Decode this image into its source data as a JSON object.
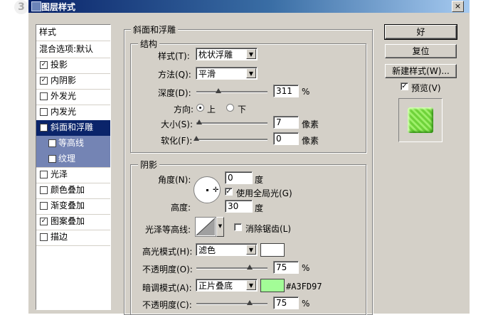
{
  "step": "3",
  "window": {
    "title": "图层样式",
    "close": "×"
  },
  "sidebar": {
    "header": "样式",
    "blend_options": "混合选项:默认",
    "items": [
      {
        "label": "投影",
        "checked": true
      },
      {
        "label": "内阴影",
        "checked": true
      },
      {
        "label": "外发光",
        "checked": false
      },
      {
        "label": "内发光",
        "checked": false
      },
      {
        "label": "斜面和浮雕",
        "checked": true
      },
      {
        "label": "等高线",
        "checked": true
      },
      {
        "label": "纹理",
        "checked": false
      },
      {
        "label": "光泽",
        "checked": false
      },
      {
        "label": "颜色叠加",
        "checked": false
      },
      {
        "label": "渐变叠加",
        "checked": false
      },
      {
        "label": "图案叠加",
        "checked": true
      },
      {
        "label": "描边",
        "checked": false
      }
    ]
  },
  "panel": {
    "title": "斜面和浮雕",
    "structure": {
      "title": "结构",
      "style_label": "样式(T):",
      "style_value": "枕状浮雕",
      "method_label": "方法(Q):",
      "method_value": "平滑",
      "depth_label": "深度(D):",
      "depth_value": "311",
      "depth_unit": "%",
      "depth_level": 0.31,
      "direction_label": "方向:",
      "dir_up": "上",
      "dir_down": "下",
      "size_label": "大小(S):",
      "size_value": "7",
      "size_unit": "像素",
      "size_level": 0.04,
      "soften_label": "软化(F):",
      "soften_value": "0",
      "soften_unit": "像素",
      "soften_level": 0.0
    },
    "shading": {
      "title": "阴影",
      "angle_label": "角度(N):",
      "angle_value": "0",
      "angle_unit": "度",
      "global_light": "使用全局光(G)",
      "altitude_label": "高度:",
      "altitude_value": "30",
      "altitude_unit": "度",
      "gloss_label": "光泽等高线:",
      "antialias": "消除锯齿(L)",
      "highlight_label": "高光模式(H):",
      "highlight_mode": "滤色",
      "highlight_color": "#ffffff",
      "opacity1_label": "不透明度(O):",
      "opacity1_value": "75",
      "opacity1_unit": "%",
      "opacity1_level": 0.75,
      "shadow_label": "暗调模式(A):",
      "shadow_mode": "正片叠底",
      "shadow_color": "#A3FD97",
      "shadow_color_text": "#A3FD97",
      "opacity2_label": "不透明度(C):",
      "opacity2_value": "75",
      "opacity2_unit": "%",
      "opacity2_level": 0.75
    }
  },
  "buttons": {
    "ok": "好",
    "reset": "复位",
    "new_style": "新建样式(W)...",
    "preview": "预览(V)"
  }
}
